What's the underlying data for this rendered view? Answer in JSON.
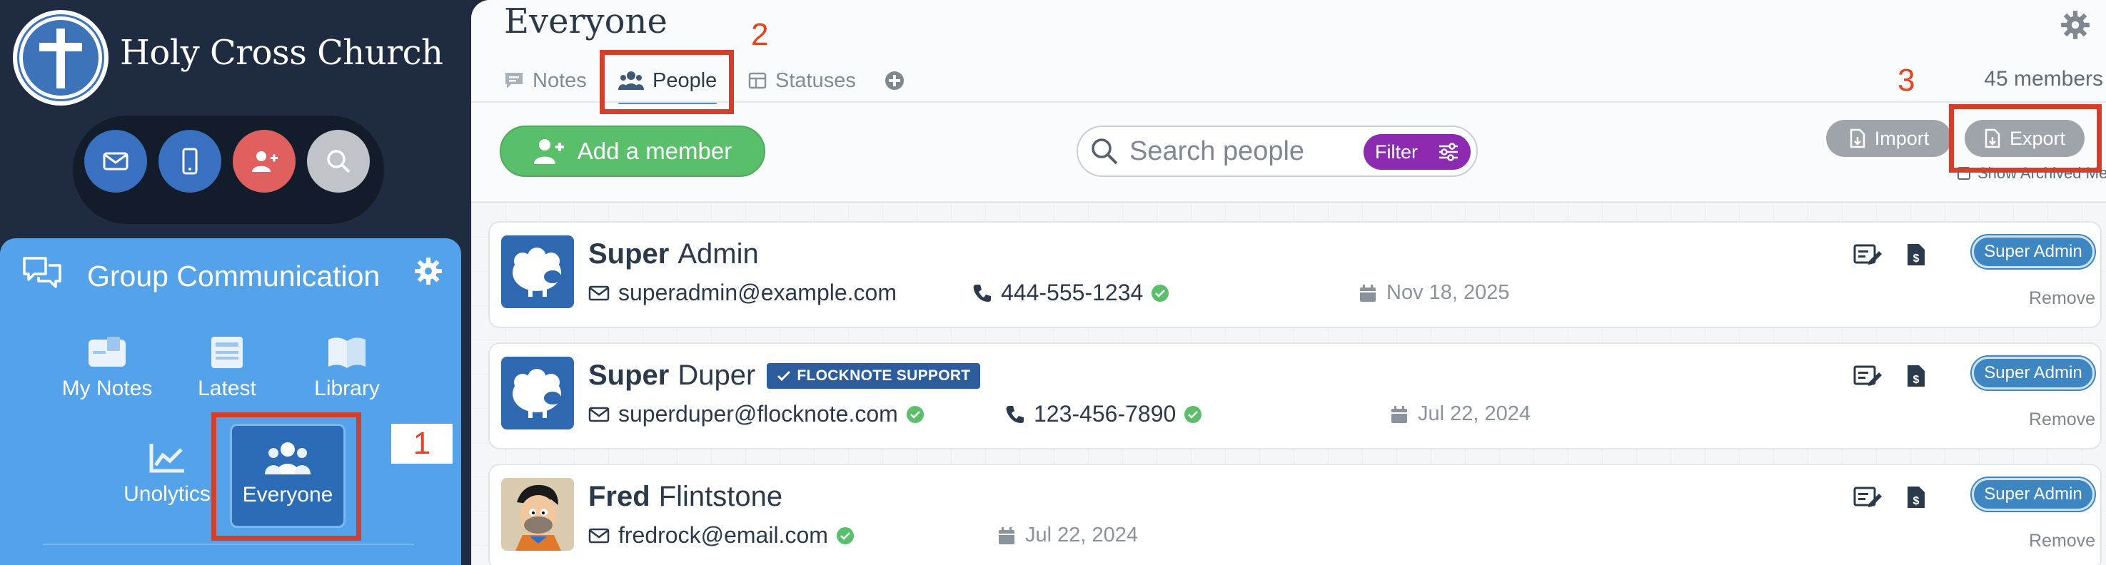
{
  "sidebar": {
    "church_name": "Holy Cross Church",
    "quick_actions": [
      {
        "name": "mail",
        "color": "#3a70c0"
      },
      {
        "name": "mobile",
        "color": "#3a70c0"
      },
      {
        "name": "add-person",
        "color": "#e06060"
      },
      {
        "name": "search",
        "color": "#c0c3c7"
      }
    ],
    "group": {
      "title": "Group Communication",
      "nav": [
        {
          "label": "My Notes"
        },
        {
          "label": "Latest"
        },
        {
          "label": "Library"
        },
        {
          "label": "Unolytics"
        },
        {
          "label": "Everyone"
        }
      ]
    }
  },
  "main": {
    "title": "Everyone",
    "tabs": [
      {
        "label": "Notes"
      },
      {
        "label": "People"
      },
      {
        "label": "Statuses"
      }
    ],
    "members_count": "45 members",
    "add_member_label": "Add a member",
    "search_placeholder": "Search people",
    "filter_label": "Filter",
    "import_label": "Import",
    "export_label": "Export",
    "show_archived_label": "Show Archived Members",
    "members": [
      {
        "first": "Super",
        "last": "Admin",
        "email": "superadmin@example.com",
        "phone": "444-555-1234",
        "date": "Nov 18, 2025",
        "role": "Super Admin",
        "remove": "Remove"
      },
      {
        "first": "Super",
        "last": "Duper",
        "badge": "FLOCKNOTE SUPPORT",
        "email": "superduper@flocknote.com",
        "phone": "123-456-7890",
        "date": "Jul 22, 2024",
        "role": "Super Admin",
        "remove": "Remove"
      },
      {
        "first": "Fred",
        "last": "Flintstone",
        "email": "fredrock@email.com",
        "date": "Jul 22, 2024",
        "role": "Super Admin",
        "remove": "Remove"
      }
    ]
  },
  "annotations": [
    "1",
    "2",
    "3"
  ],
  "colors": {
    "accent_green": "#5abf6a",
    "filter_purple": "#8c2bb0",
    "role_blue": "#3e86c2",
    "annotation_red": "#d23f2a"
  }
}
